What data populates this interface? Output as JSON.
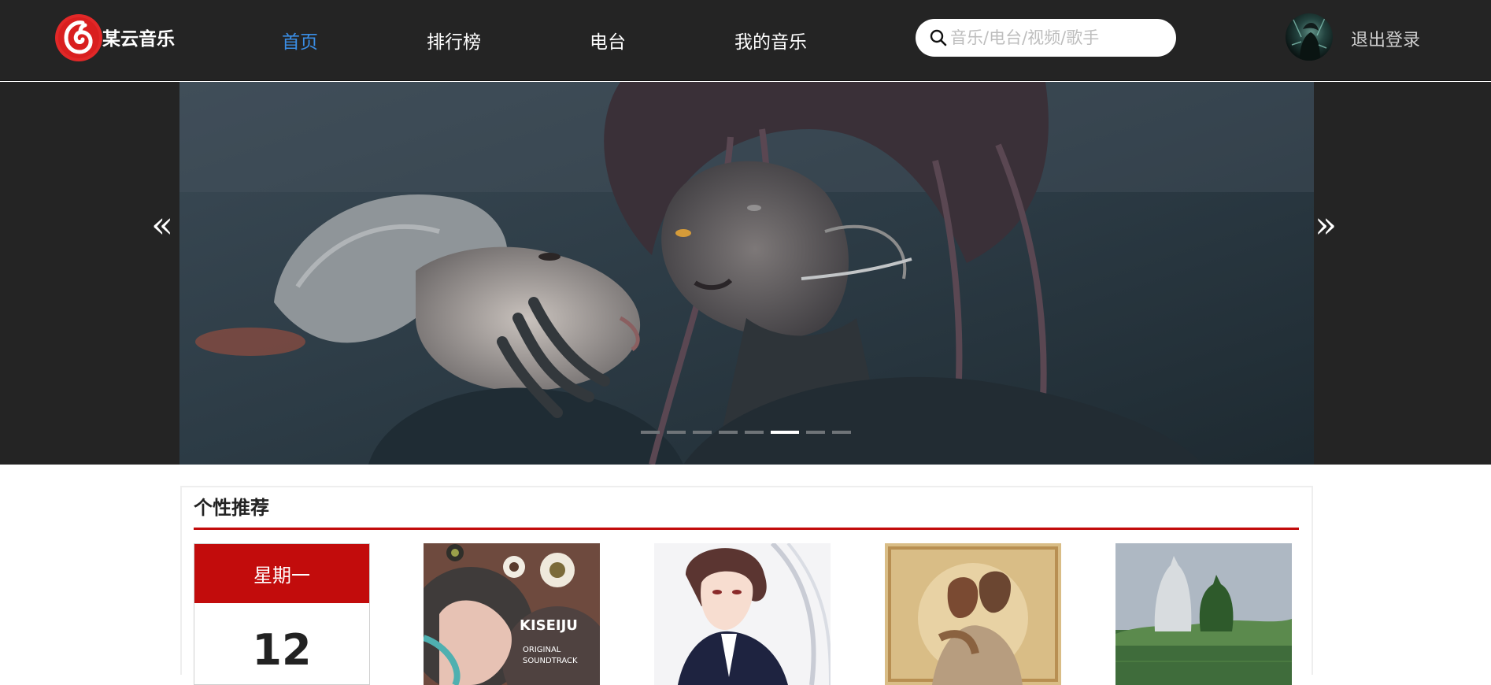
{
  "header": {
    "brand": "某云音乐",
    "nav": [
      "首页",
      "排行榜",
      "电台",
      "我的音乐"
    ],
    "active_nav": "首页",
    "search": {
      "placeholder": "音乐/电台/视频/歌手",
      "value": ""
    },
    "logout_label": "退出登录"
  },
  "banner": {
    "prev_glyph": "«",
    "next_glyph": "»",
    "slide_count": 8,
    "active_slide": 6
  },
  "recommend": {
    "title": "个性推荐",
    "calendar": {
      "weekday": "星期一",
      "day": "12"
    },
    "playlists": [
      {
        "art_text": "KISEIJU ORIGINAL SOUNDTRACK"
      },
      {
        "art_text": ""
      },
      {
        "art_text": ""
      },
      {
        "art_text": ""
      }
    ]
  },
  "colors": {
    "topbar": "#242424",
    "accent_red": "#c20c0c",
    "nav_active": "#3a8ee6"
  }
}
